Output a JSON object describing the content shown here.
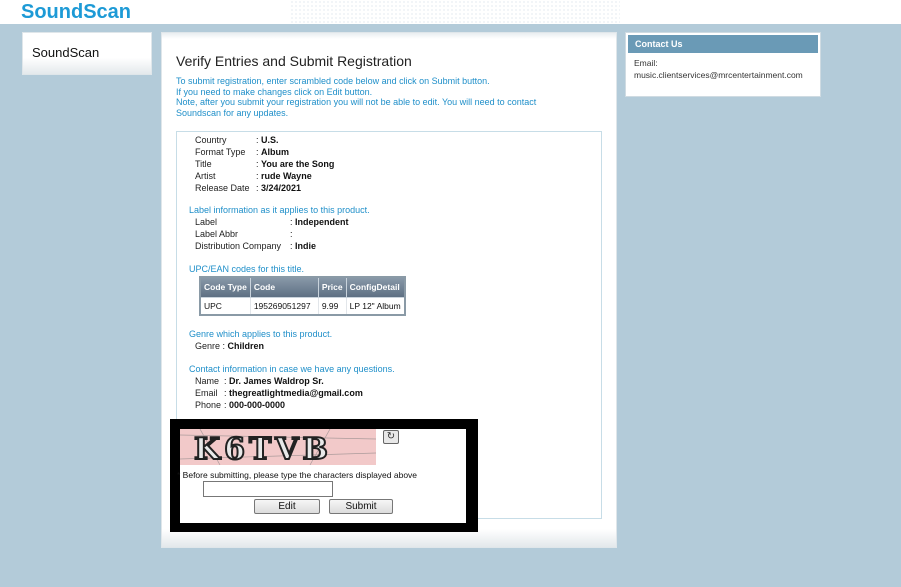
{
  "app": {
    "brand": "SoundScan"
  },
  "left_nav": {
    "label": "SoundScan"
  },
  "main": {
    "title": "Verify Entries and Submit Registration",
    "intro_lines": [
      "To submit registration, enter scrambled code below and click on Submit button.",
      "If you need to make changes click on Edit button.",
      "Note, after you submit your registration you will not be able to edit. You will need to contact",
      "Soundscan for any updates."
    ]
  },
  "product": {
    "country_label": "Country",
    "country": "U.S.",
    "format_label": "Format Type",
    "format": "Album",
    "title_label": "Title",
    "title": "You are the Song",
    "artist_label": "Artist",
    "artist": "rude Wayne",
    "release_label": "Release Date",
    "release": "3/24/2021"
  },
  "label_info": {
    "heading": "Label information as it applies to this product.",
    "label_label": "Label",
    "label": "Independent",
    "abbr_label": "Label Abbr",
    "abbr": "",
    "dist_label": "Distribution Company",
    "dist": "Indie"
  },
  "upc": {
    "heading": "UPC/EAN codes for this title.",
    "columns": [
      "Code Type",
      "Code",
      "Price",
      "ConfigDetail"
    ],
    "rows": [
      [
        "UPC",
        "195269051297",
        "9.99",
        "LP 12\" Album"
      ]
    ]
  },
  "genre": {
    "heading": "Genre which applies to this product.",
    "label": "Genre",
    "value": "Children"
  },
  "contact_info": {
    "heading": "Contact information in case we have any questions.",
    "name_label": "Name",
    "name": "Dr. James Waldrop Sr.",
    "email_label": "Email",
    "email": "thegreatlightmedia@gmail.com",
    "phone_label": "Phone",
    "phone": "000-000-0000"
  },
  "captcha": {
    "text": "K6TVB",
    "label": "* Before submitting, please type the characters displayed above",
    "input_value": "",
    "edit_label": "Edit",
    "submit_label": "Submit"
  },
  "contact_box": {
    "title": "Contact Us",
    "email_label": "Email:",
    "email": "music.clientservices@mrcentertainment.com"
  },
  "colors": {
    "brand": "#1d9ad6",
    "background": "#b3cbd9",
    "link": "#1f8fc9",
    "contact_header": "#6a9ab6"
  }
}
